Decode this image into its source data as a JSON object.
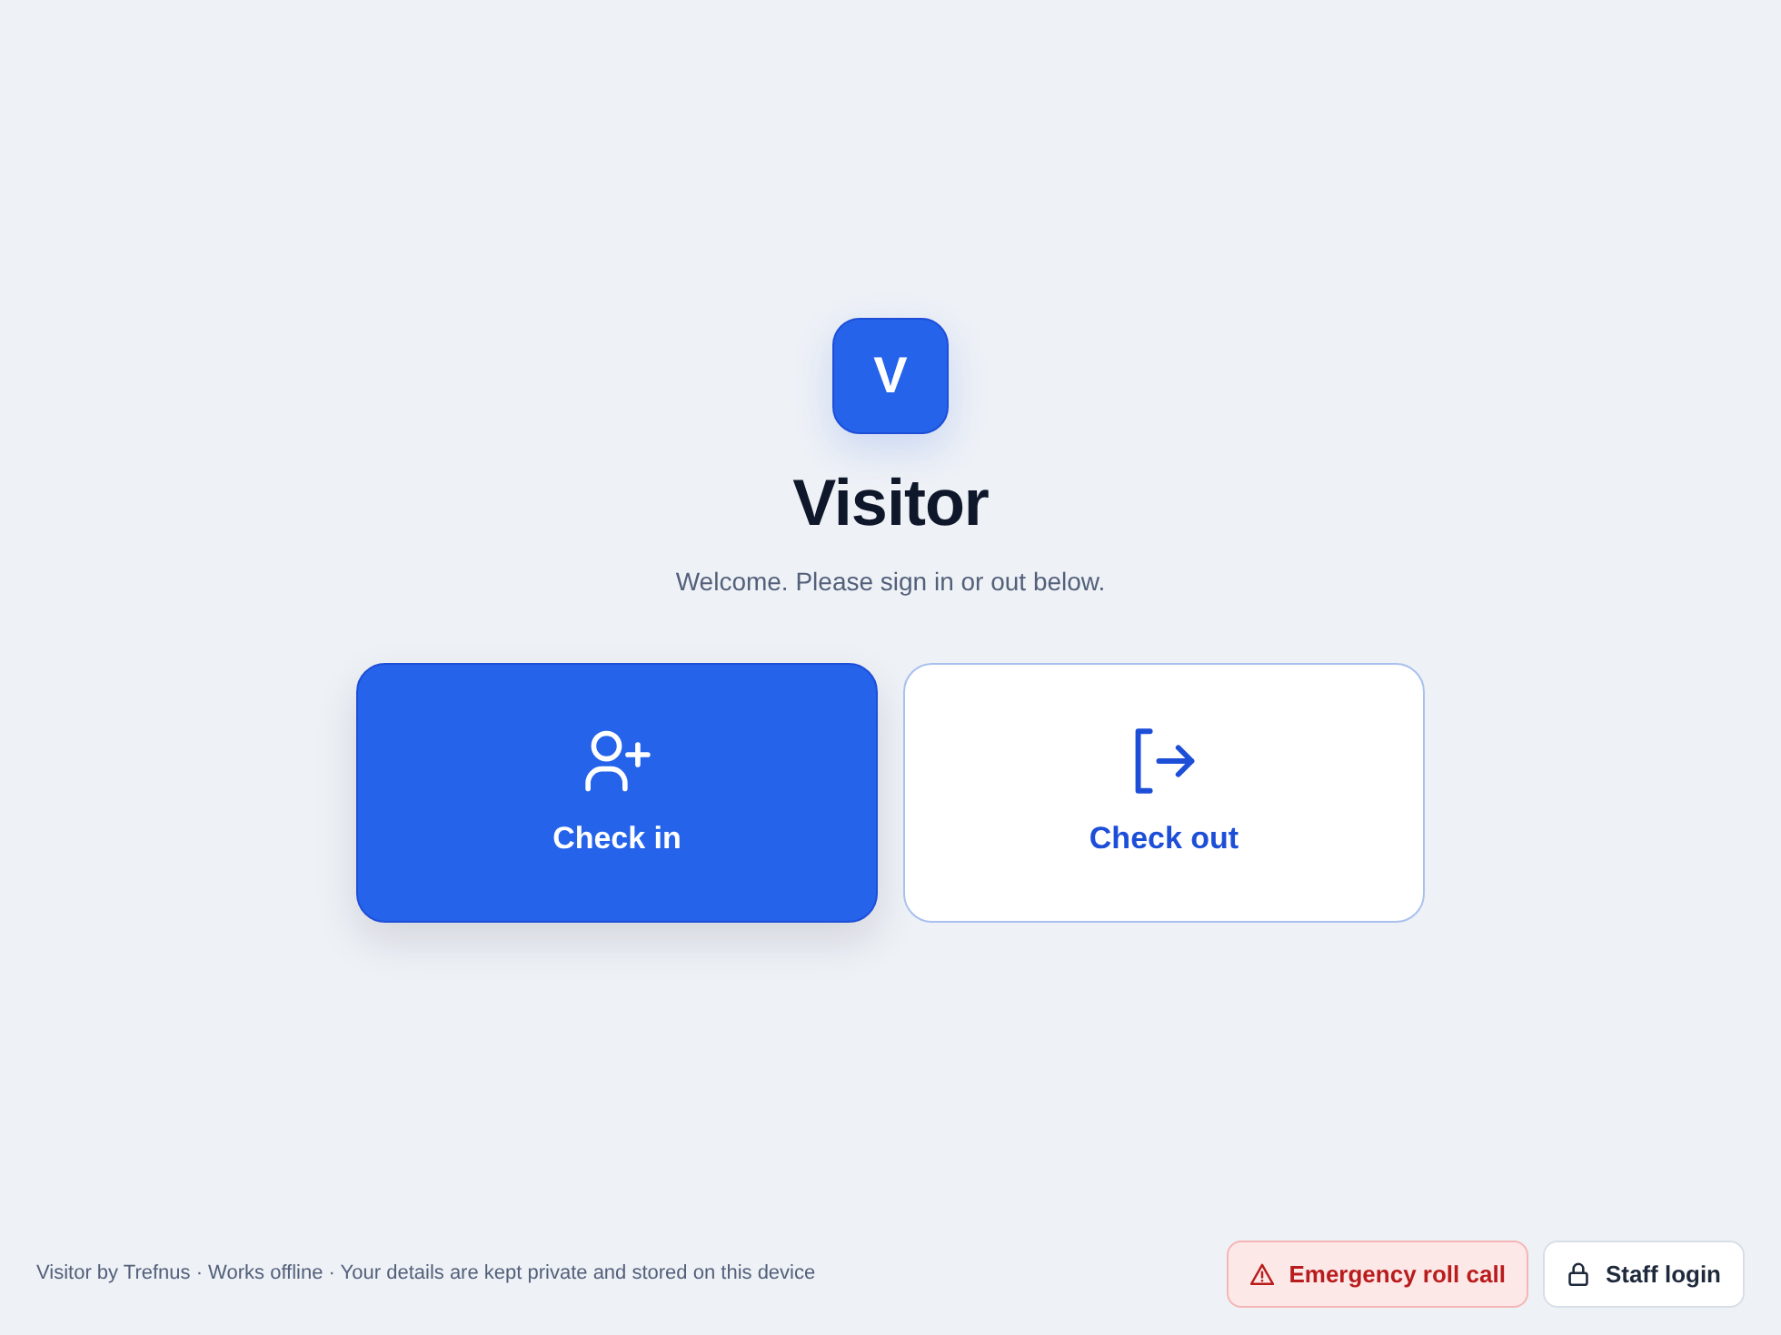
{
  "logo": {
    "letter": "V"
  },
  "title": "Visitor",
  "subtitle": "Welcome. Please sign in or out below.",
  "actions": [
    {
      "label": "Check in",
      "kind": "check_in"
    },
    {
      "label": "Check out",
      "kind": "check_out"
    }
  ],
  "footer": {
    "note": "Visitor by Trefnus · Works offline · Your details are kept private and stored on this device",
    "buttons": [
      {
        "label": "Emergency roll call",
        "kind": "emergency"
      },
      {
        "label": "Staff login",
        "kind": "staff"
      }
    ]
  }
}
